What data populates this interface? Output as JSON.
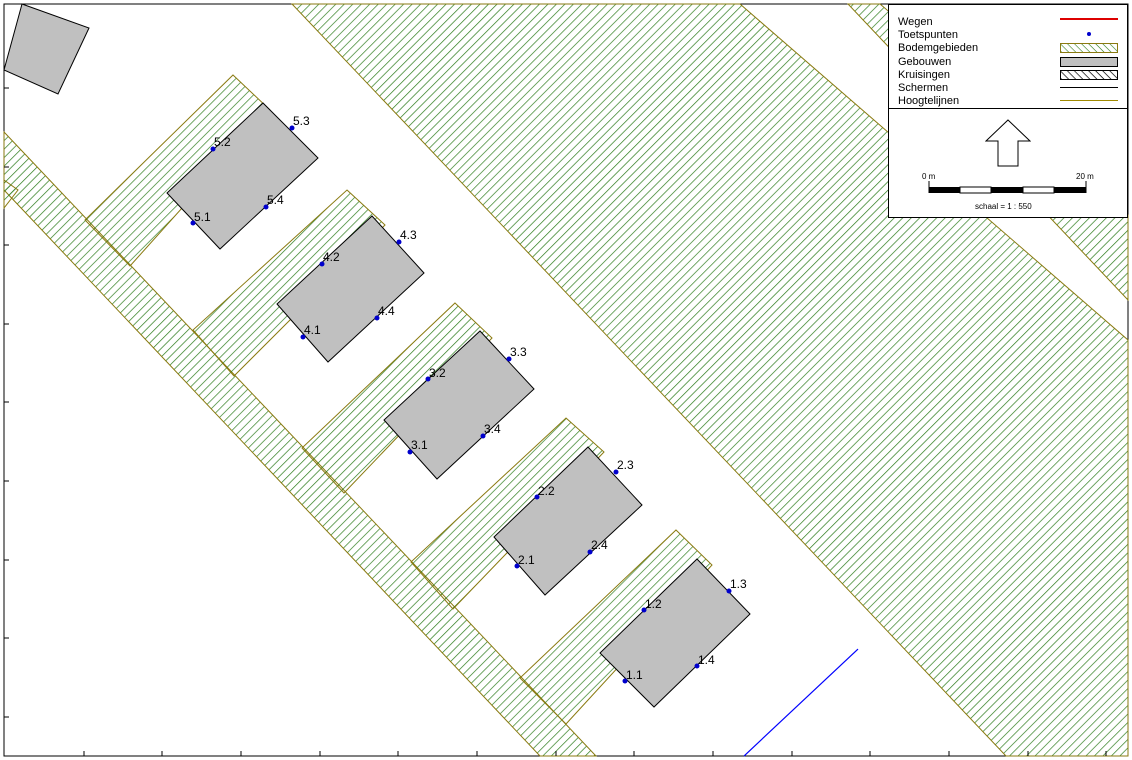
{
  "legend": {
    "items": [
      {
        "label": "Wegen",
        "symbol": "road-line"
      },
      {
        "label": "Toetspunten",
        "symbol": "test-point-dot"
      },
      {
        "label": "Bodemgebieden",
        "symbol": "ground-hatch"
      },
      {
        "label": "Gebouwen",
        "symbol": "building-fill"
      },
      {
        "label": "Kruisingen",
        "symbol": "crossing-hatch"
      },
      {
        "label": "Schermen",
        "symbol": "screen-line"
      },
      {
        "label": "Hoogtelijnen",
        "symbol": "contour-line"
      }
    ]
  },
  "north_arrow": {
    "icon": "north-arrow-icon"
  },
  "scale": {
    "start_label": "0 m",
    "end_label": "20 m",
    "ratio_label": "schaal = 1 : 550"
  },
  "test_points": [
    {
      "label": "1.1"
    },
    {
      "label": "1.2"
    },
    {
      "label": "1.3"
    },
    {
      "label": "1.4"
    },
    {
      "label": "2.1"
    },
    {
      "label": "2.2"
    },
    {
      "label": "2.3"
    },
    {
      "label": "2.4"
    },
    {
      "label": "3.1"
    },
    {
      "label": "3.2"
    },
    {
      "label": "3.3"
    },
    {
      "label": "3.4"
    },
    {
      "label": "4.1"
    },
    {
      "label": "4.2"
    },
    {
      "label": "4.3"
    },
    {
      "label": "4.4"
    },
    {
      "label": "5.1"
    },
    {
      "label": "5.2"
    },
    {
      "label": "5.3"
    },
    {
      "label": "5.4"
    }
  ],
  "colors": {
    "ground_hatch": "#2e7d1e",
    "ground_outline": "#8a7a10",
    "building_fill": "#c0c0c0",
    "building_stroke": "#000000",
    "test_point": "#0000cc",
    "road": "#dd0000",
    "screen_line": "#0000ff",
    "contour_line": "#a08a00"
  }
}
